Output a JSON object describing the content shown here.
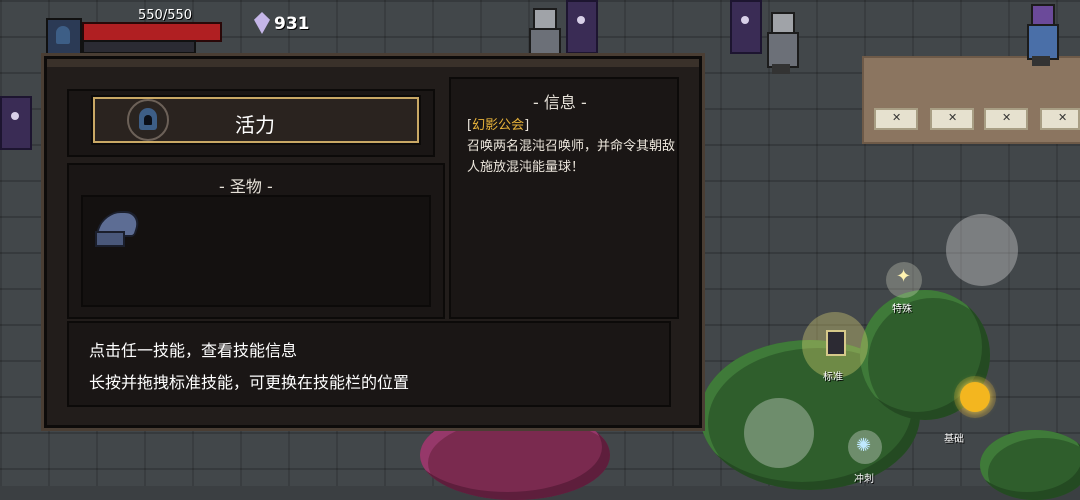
{
  "hud": {
    "hp_text": "550/550",
    "hp_fraction": 1.0,
    "gem_count": "931"
  },
  "panel": {
    "selected_skill_label": "活力",
    "relics_title": "- 圣物 -",
    "info_title": "- 信息 -",
    "info": {
      "guild_tag_open": "[",
      "guild_name": "幻影公会",
      "guild_tag_close": "]",
      "description": "召唤两名混沌召唤师，并命令其朝敌人施放混沌能量球！"
    },
    "hint_line1": "点击任一技能，查看技能信息",
    "hint_line2": "长按并拖拽标准技能，可更换在技能栏的位置"
  },
  "controls": {
    "special_label": "特殊",
    "standard_label": "标准",
    "basic_label": "基础",
    "dash_label": "冲刺"
  },
  "icons": {
    "skill_icon": "hooded-figure-icon",
    "relic_icon": "blue-hood-cloak-icon"
  },
  "colors": {
    "hp_red": "#b01f22",
    "guild_gold": "#e8b33a",
    "tab_border_gold": "#c9a865",
    "panel_bg": "#221d1b"
  }
}
